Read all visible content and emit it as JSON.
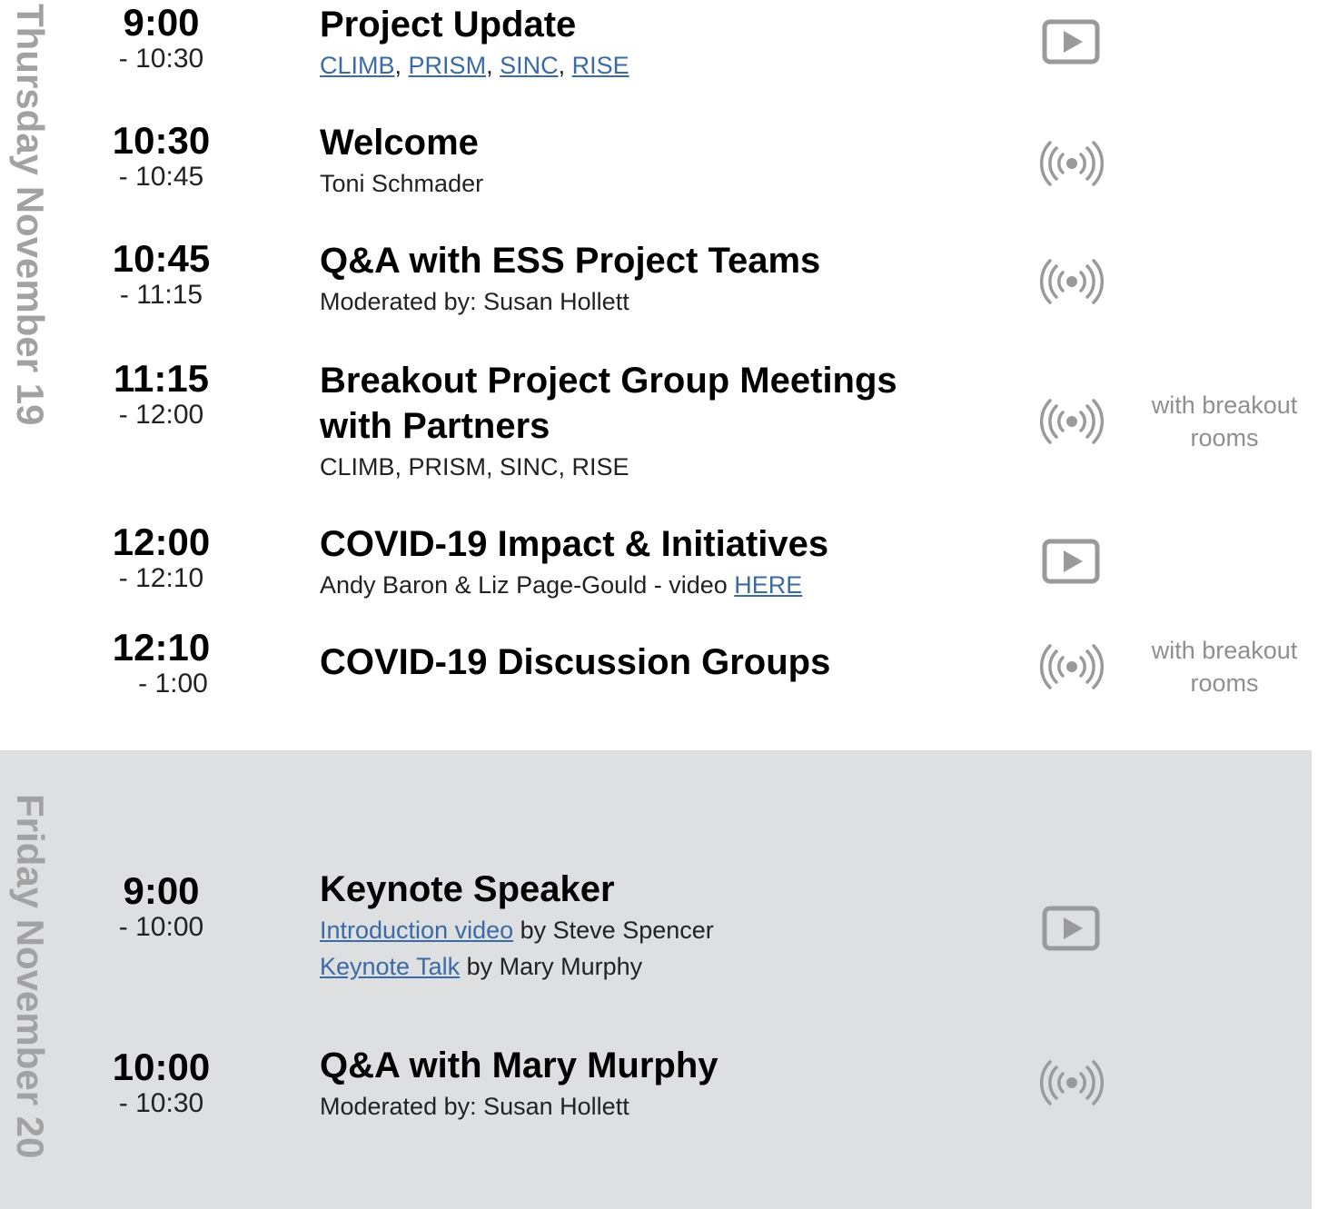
{
  "thursday": {
    "label": "Thursday November 19",
    "sessions": [
      {
        "start": "9:00",
        "end": "- 10:30",
        "title": "Project Update",
        "links": [
          "CLIMB",
          "PRISM",
          "SINC",
          "RISE"
        ],
        "icon": "play-icon"
      },
      {
        "start": "10:30",
        "end": "- 10:45",
        "title": "Welcome",
        "subtitle": "Toni Schmader",
        "icon": "live-broadcast-icon"
      },
      {
        "start": "10:45",
        "end": "- 11:15",
        "title": "Q&A with ESS Project Teams",
        "subtitle": "Moderated by: Susan Hollett",
        "icon": "live-broadcast-icon"
      },
      {
        "start": "11:15",
        "end": "- 12:00",
        "title_line1": "Breakout Project Group Meetings",
        "title_line2": "with Partners",
        "subtitle": "CLIMB, PRISM, SINC, RISE",
        "icon": "live-broadcast-icon",
        "note": "with breakout rooms"
      },
      {
        "start": "12:00",
        "end": "- 12:10",
        "title": "COVID-19 Impact & Initiatives",
        "subtitle_prefix": "Andy Baron & Liz Page-Gould - video ",
        "link": "HERE",
        "icon": "play-icon"
      },
      {
        "start": "12:10",
        "end": "- 1:00",
        "title": "COVID-19 Discussion Groups",
        "icon": "live-broadcast-icon",
        "note": "with breakout rooms"
      }
    ]
  },
  "friday": {
    "label": "Friday November 20",
    "sessions": [
      {
        "start": "9:00",
        "end": "- 10:00",
        "title": "Keynote Speaker",
        "line1_link": "Introduction video",
        "line1_rest": " by Steve Spencer",
        "line2_link": "Keynote Talk",
        "line2_rest": " by Mary Murphy",
        "icon": "play-icon"
      },
      {
        "start": "10:00",
        "end": "- 10:30",
        "title": "Q&A with Mary Murphy",
        "subtitle": "Moderated by: Susan Hollett",
        "icon": "live-broadcast-icon"
      }
    ]
  },
  "colors": {
    "link": "#3b6ba6",
    "day_label": "#a2a2a2",
    "friday_bg": "#dedfe1",
    "icon": "#9a9a9a",
    "note": "#8f8f8f"
  }
}
